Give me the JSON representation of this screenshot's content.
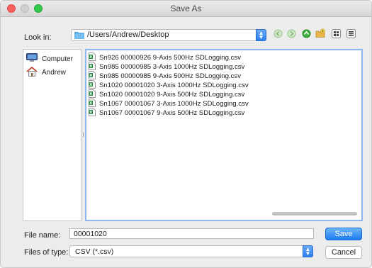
{
  "window": {
    "title": "Save As"
  },
  "look_in": {
    "label": "Look in:",
    "path": "/Users/Andrew/Desktop"
  },
  "toolbar": {
    "buttons": [
      "back-icon",
      "forward-icon",
      "parent-folder-icon",
      "new-folder-icon",
      "list-view-icon",
      "detail-view-icon"
    ]
  },
  "places": [
    {
      "label": "Computer",
      "icon": "computer-icon"
    },
    {
      "label": "Andrew",
      "icon": "home-icon"
    }
  ],
  "files": [
    "Sn926 00000926 9-Axis 500Hz SDLogging.csv",
    "Sn985 00000985 3-Axis 1000Hz SDLogging.csv",
    "Sn985 00000985 9-Axis 500Hz SDLogging.csv",
    "Sn1020 00001020 3-Axis 1000Hz SDLogging.csv",
    "Sn1020 00001020 9-Axis 500Hz SDLogging.csv",
    "Sn1067 00001067 3-Axis 1000Hz SDLogging.csv",
    "Sn1067 00001067 9-Axis 500Hz SDLogging.csv"
  ],
  "file_name": {
    "label": "File name:",
    "value": "00001020"
  },
  "file_type": {
    "label": "Files of type:",
    "value": "CSV (*.csv)"
  },
  "buttons": {
    "save": "Save",
    "cancel": "Cancel"
  },
  "colors": {
    "accent": "#2d7ef2",
    "selection_border": "#8db8ee",
    "close": "#fc605c",
    "maximize": "#34c84a"
  }
}
